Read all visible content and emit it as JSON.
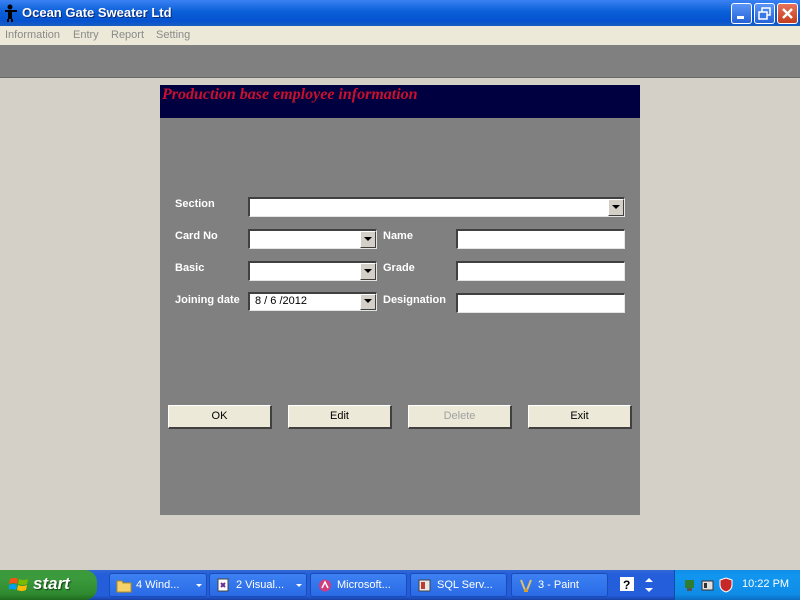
{
  "window": {
    "title": "Ocean Gate Sweater Ltd"
  },
  "menu": {
    "items": [
      "Information",
      "Entry",
      "Report",
      "Setting"
    ]
  },
  "form": {
    "heading": "Production base employee information",
    "labels": {
      "section": "Section",
      "card_no": "Card No",
      "name": "Name",
      "basic": "Basic",
      "grade": "Grade",
      "joining_date": "Joining date",
      "designation": "Designation"
    },
    "values": {
      "section": "",
      "card_no": "",
      "name": "",
      "basic": "",
      "grade": "",
      "joining_date": "8 / 6 /2012",
      "designation": ""
    },
    "buttons": {
      "ok": "OK",
      "edit": "Edit",
      "delete": "Delete",
      "exit": "Exit"
    }
  },
  "taskbar": {
    "start_label": "start",
    "tasks": [
      "4 Wind...",
      "2 Visual...",
      "Microsoft...",
      "SQL Serv...",
      "3 - Paint"
    ],
    "clock": "10:22 PM"
  },
  "colors": {
    "heading_bg": "#000040",
    "heading_text": "#c8102e",
    "panel_bg": "#808080",
    "titlebar": "#0a5fd8"
  },
  "icons": {
    "app": "tool-person-icon",
    "minimize": "minimize-icon",
    "restore": "restore-icon",
    "close": "close-icon"
  }
}
